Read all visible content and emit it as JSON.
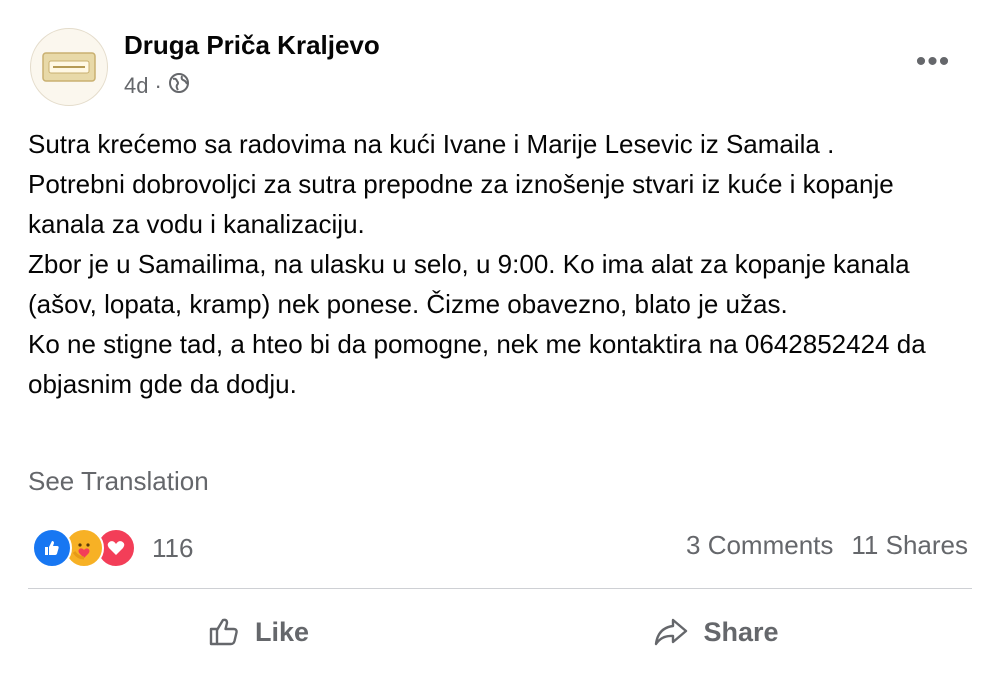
{
  "post": {
    "page_name": "Druga Priča Kraljevo",
    "timestamp": "4d",
    "separator": "·",
    "audience_icon": "globe-icon",
    "more_icon": "more-horizontal-icon",
    "more_label": "•••",
    "body_lines": [
      "Sutra krećemo sa radovima na kući Ivane i Marije Lesevic iz Samaila .",
      "Potrebni dobrovoljci za sutra prepodne za iznošenje stvari iz kuće i kopanje kanala za vodu i kanalizaciju.",
      "Zbor je u Samailima, na ulasku u selo, u 9:00. Ko ima alat za kopanje kanala (ašov, lopata, kramp) nek ponese. Čizme obavezno, blato je užas.",
      "Ko ne stigne tad, a hteo bi da pomogne, nek me kontaktira na 0642852424 da objasnim gde da dodju."
    ],
    "see_translation": "See Translation"
  },
  "engagement": {
    "reaction_icons": [
      "like-reaction-icon",
      "care-reaction-icon",
      "love-reaction-icon"
    ],
    "reaction_count": "116",
    "comments": "3 Comments",
    "shares": "11 Shares"
  },
  "actions": {
    "like_label": "Like",
    "like_icon": "thumbs-up-icon",
    "share_label": "Share",
    "share_icon": "share-arrow-icon"
  },
  "colors": {
    "brand_blue": "#1877f2",
    "secondary_text": "#65676b",
    "primary_text": "#050505",
    "divider": "#ced0d4"
  }
}
